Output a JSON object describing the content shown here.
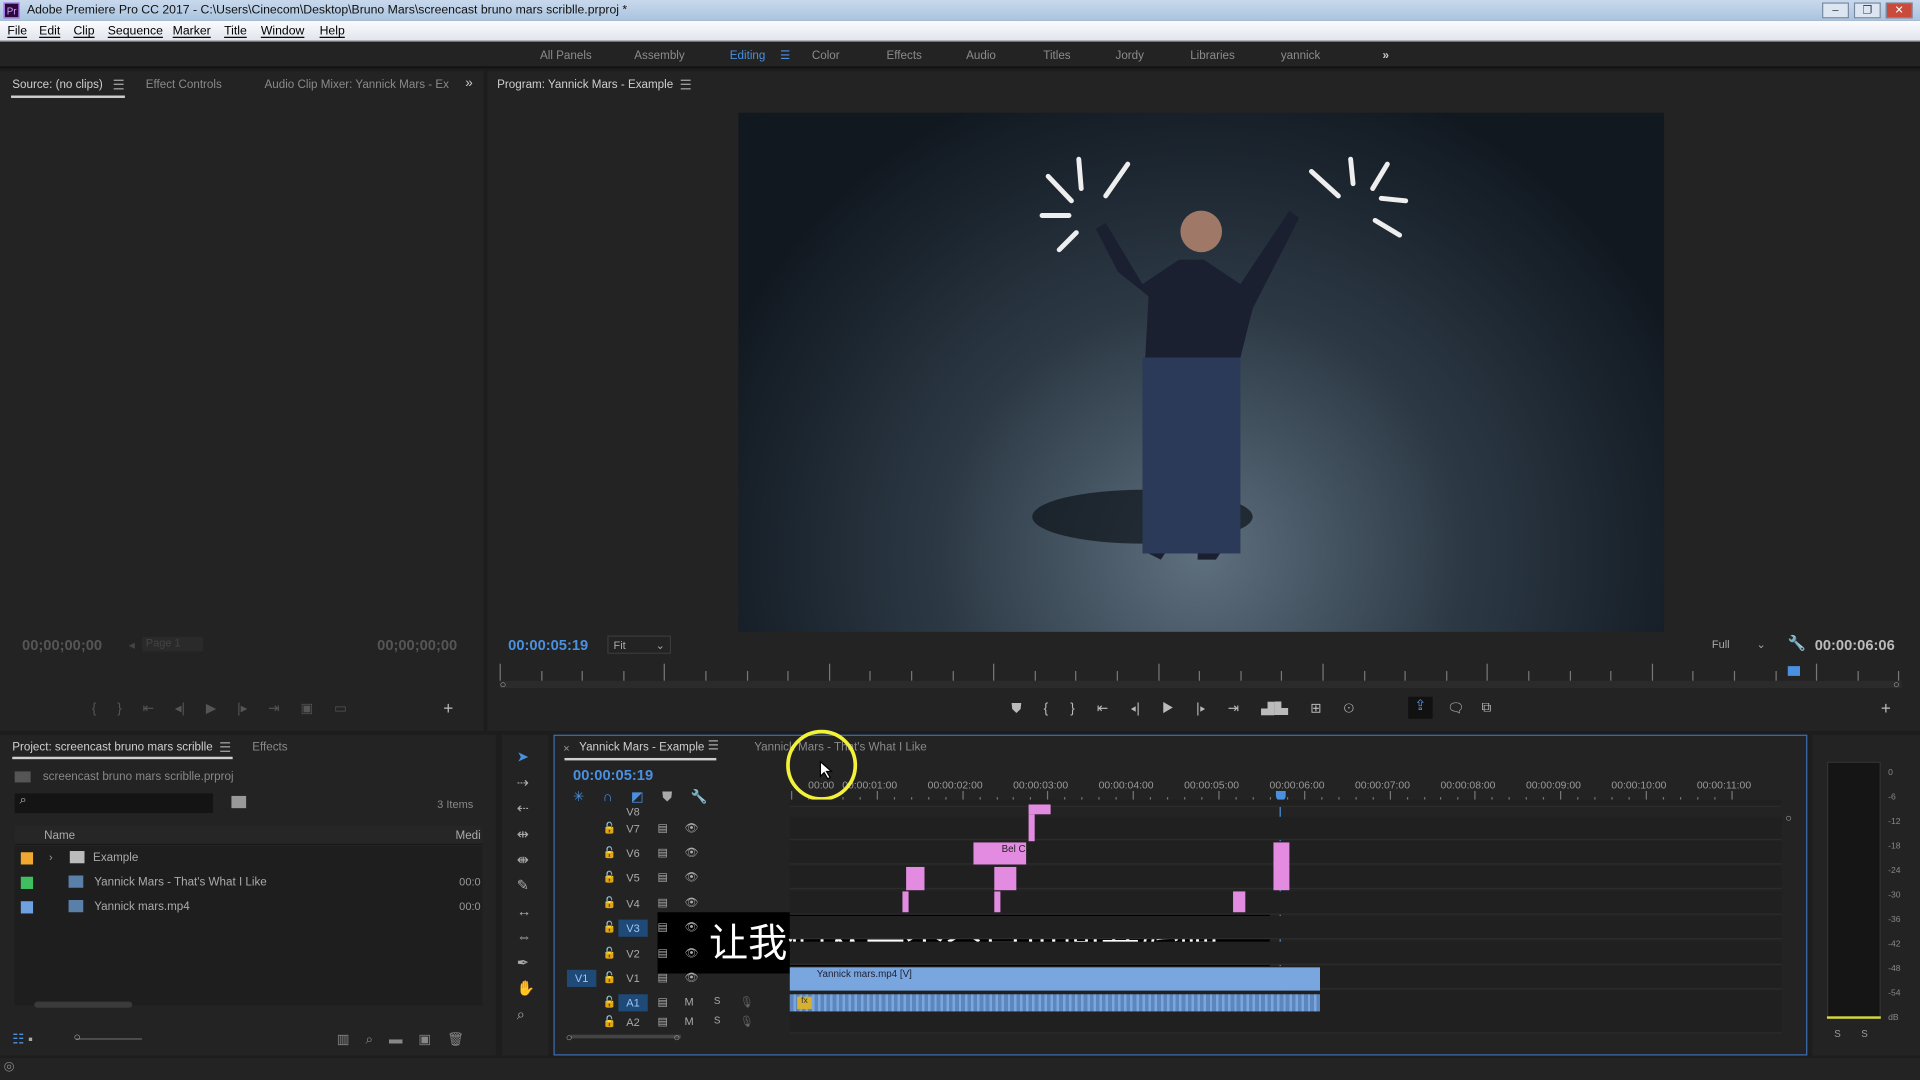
{
  "window": {
    "title": "Adobe Premiere Pro CC 2017 - C:\\Users\\Cinecom\\Desktop\\Bruno Mars\\screencast bruno mars scriblle.prproj *",
    "logo": "Pr",
    "min": "–",
    "max": "❐",
    "close": "✕"
  },
  "menu": [
    "File",
    "Edit",
    "Clip",
    "Sequence",
    "Marker",
    "Title",
    "Window",
    "Help"
  ],
  "workspaces": {
    "items": [
      "All Panels",
      "Assembly",
      "Editing",
      "Color",
      "Effects",
      "Audio",
      "Titles",
      "Jordy",
      "Libraries",
      "yannick"
    ],
    "active": "Editing",
    "more": "»"
  },
  "source": {
    "tabs": [
      "Source: (no clips)",
      "Effect Controls",
      "Audio Clip Mixer: Yannick Mars - Ex"
    ],
    "more": "»",
    "tc_left": "00;00;00;00",
    "tc_right": "00;00;00;00",
    "page": "Page 1"
  },
  "program": {
    "tab": "Program: Yannick Mars - Example",
    "timecode": "00:00:05:19",
    "fit": "Fit",
    "quality": "Full",
    "duration": "00:00:06:06"
  },
  "project": {
    "tabs": [
      "Project: screencast bruno mars scriblle",
      "Effects"
    ],
    "file": "screencast bruno mars scriblle.prproj",
    "count": "3 Items",
    "col_name": "Name",
    "col_media": "Medi",
    "items": [
      {
        "name": "Example",
        "color": "#f0a830",
        "type": "folder",
        "media": ""
      },
      {
        "name": "Yannick Mars - That's What I Like",
        "color": "#3fbf5f",
        "type": "sequence",
        "media": "00:0"
      },
      {
        "name": "Yannick mars.mp4",
        "color": "#6fa0e0",
        "type": "video",
        "media": "00:0"
      }
    ]
  },
  "timeline": {
    "tabs": [
      "Yannick Mars - Example",
      "Yannick Mars - That's What I Like"
    ],
    "close": "×",
    "timecode": "00:00:05:19",
    "ruler": [
      "00:00",
      "00:00:01:00",
      "00:00:02:00",
      "00:00:03:00",
      "00:00:04:00",
      "00:00:05:00",
      "00:00:06:00",
      "00:00:07:00",
      "00:00:08:00",
      "00:00:09:00",
      "00:00:10:00",
      "00:00:11:00"
    ],
    "tracks": [
      "V8",
      "V7",
      "V6",
      "V5",
      "V4",
      "V3",
      "V2",
      "V1",
      "A1",
      "A2"
    ],
    "clip_v1": "Yannick mars.mp4 [V]",
    "clip_v6": "Bel C",
    "playhead_seconds": 5.79
  },
  "meters": {
    "scale": [
      "0",
      "-6",
      "-12",
      "-18",
      "-24",
      "-30",
      "-36",
      "-42",
      "-48",
      "-54",
      "dB"
    ],
    "solo": [
      "S",
      "S"
    ]
  },
  "subtitle": "让我们从一个空白页面开始吧",
  "colors": {
    "accent": "#4a90e0",
    "clip_graphic": "#e38be0",
    "clip_video": "#7aa6e0",
    "render_green": "#3fbf3f",
    "render_yellow": "#e0e040"
  }
}
